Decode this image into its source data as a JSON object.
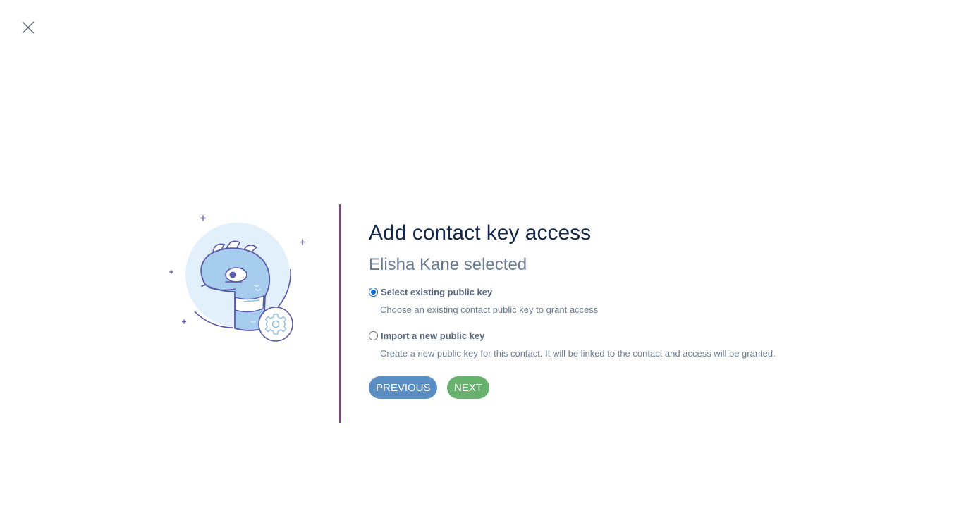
{
  "window": {
    "close_icon": "close-icon"
  },
  "illustration": {
    "icon": "snake-mascot-with-gear",
    "colors": {
      "circle": "#e1f0fb",
      "body": "#a6cdee",
      "outline": "#5a58a8"
    }
  },
  "dialog": {
    "title": "Add contact key access",
    "subtitle": "Elisha Kane selected",
    "divider_color": "#8e3a8e",
    "options": [
      {
        "label": "Select existing public key",
        "description": "Choose an existing contact public key to grant access",
        "checked": true
      },
      {
        "label": "Import a new public key",
        "description": "Create a new public key for this contact. It will be linked to the contact and access will be granted.",
        "checked": false
      }
    ],
    "buttons": {
      "previous": "PREVIOUS",
      "next": "NEXT"
    }
  },
  "colors": {
    "title": "#12284a",
    "muted": "#6b7b93",
    "previous_button": "#5b8fc4",
    "next_button": "#69b16f",
    "radio_accent": "#0b66d8"
  }
}
